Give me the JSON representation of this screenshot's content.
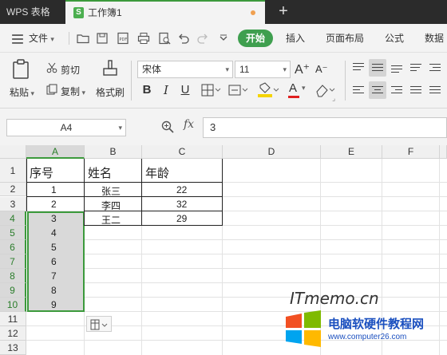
{
  "titlebar": {
    "app_label": "WPS 表格",
    "doc_icon": "S",
    "doc_title": "工作簿1",
    "new_tab": "+"
  },
  "menubar": {
    "file": "文件",
    "tabs": [
      "开始",
      "插入",
      "页面布局",
      "公式",
      "数据"
    ]
  },
  "ribbon": {
    "paste": "粘贴",
    "cut": "剪切",
    "copy": "复制",
    "format_painter": "格式刷",
    "font_name": "宋体",
    "font_size": "11",
    "grow_font": "A⁺",
    "shrink_font": "A⁻",
    "bold": "B",
    "italic": "I",
    "underline": "U",
    "font_color_letter": "A"
  },
  "formulabar": {
    "cell_ref": "A4",
    "fx": "fx",
    "value": "3"
  },
  "grid": {
    "columns": [
      "A",
      "B",
      "C",
      "D",
      "E",
      "F"
    ],
    "rows": [
      "1",
      "2",
      "3",
      "4",
      "5",
      "6",
      "7",
      "8",
      "9",
      "10",
      "11",
      "12",
      "13"
    ],
    "headers": [
      "序号",
      "姓名",
      "年龄"
    ],
    "data": [
      [
        "1",
        "张三",
        "22"
      ],
      [
        "2",
        "李四",
        "32"
      ],
      [
        "3",
        "王二",
        "29"
      ]
    ],
    "extra_seq": [
      "4",
      "5",
      "6",
      "7",
      "8",
      "9"
    ]
  },
  "watermark": {
    "text": "ITmemo.cn",
    "logo_title": "电脑软硬件教程网",
    "logo_url": "www.computer26.com"
  },
  "colors": {
    "accent": "#3c9a3c",
    "title_bg": "#2b2b2b",
    "selection": "#d9d9d9"
  }
}
